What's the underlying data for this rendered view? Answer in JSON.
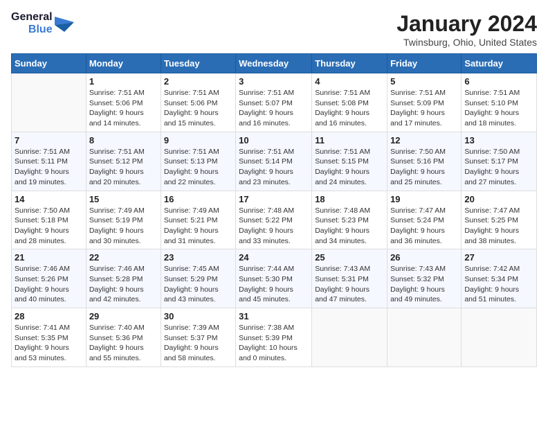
{
  "header": {
    "logo_general": "General",
    "logo_blue": "Blue",
    "month_title": "January 2024",
    "location": "Twinsburg, Ohio, United States"
  },
  "calendar": {
    "days_of_week": [
      "Sunday",
      "Monday",
      "Tuesday",
      "Wednesday",
      "Thursday",
      "Friday",
      "Saturday"
    ],
    "weeks": [
      [
        {
          "day": "",
          "info": ""
        },
        {
          "day": "1",
          "info": "Sunrise: 7:51 AM\nSunset: 5:06 PM\nDaylight: 9 hours\nand 14 minutes."
        },
        {
          "day": "2",
          "info": "Sunrise: 7:51 AM\nSunset: 5:06 PM\nDaylight: 9 hours\nand 15 minutes."
        },
        {
          "day": "3",
          "info": "Sunrise: 7:51 AM\nSunset: 5:07 PM\nDaylight: 9 hours\nand 16 minutes."
        },
        {
          "day": "4",
          "info": "Sunrise: 7:51 AM\nSunset: 5:08 PM\nDaylight: 9 hours\nand 16 minutes."
        },
        {
          "day": "5",
          "info": "Sunrise: 7:51 AM\nSunset: 5:09 PM\nDaylight: 9 hours\nand 17 minutes."
        },
        {
          "day": "6",
          "info": "Sunrise: 7:51 AM\nSunset: 5:10 PM\nDaylight: 9 hours\nand 18 minutes."
        }
      ],
      [
        {
          "day": "7",
          "info": "Sunrise: 7:51 AM\nSunset: 5:11 PM\nDaylight: 9 hours\nand 19 minutes."
        },
        {
          "day": "8",
          "info": "Sunrise: 7:51 AM\nSunset: 5:12 PM\nDaylight: 9 hours\nand 20 minutes."
        },
        {
          "day": "9",
          "info": "Sunrise: 7:51 AM\nSunset: 5:13 PM\nDaylight: 9 hours\nand 22 minutes."
        },
        {
          "day": "10",
          "info": "Sunrise: 7:51 AM\nSunset: 5:14 PM\nDaylight: 9 hours\nand 23 minutes."
        },
        {
          "day": "11",
          "info": "Sunrise: 7:51 AM\nSunset: 5:15 PM\nDaylight: 9 hours\nand 24 minutes."
        },
        {
          "day": "12",
          "info": "Sunrise: 7:50 AM\nSunset: 5:16 PM\nDaylight: 9 hours\nand 25 minutes."
        },
        {
          "day": "13",
          "info": "Sunrise: 7:50 AM\nSunset: 5:17 PM\nDaylight: 9 hours\nand 27 minutes."
        }
      ],
      [
        {
          "day": "14",
          "info": "Sunrise: 7:50 AM\nSunset: 5:18 PM\nDaylight: 9 hours\nand 28 minutes."
        },
        {
          "day": "15",
          "info": "Sunrise: 7:49 AM\nSunset: 5:19 PM\nDaylight: 9 hours\nand 30 minutes."
        },
        {
          "day": "16",
          "info": "Sunrise: 7:49 AM\nSunset: 5:21 PM\nDaylight: 9 hours\nand 31 minutes."
        },
        {
          "day": "17",
          "info": "Sunrise: 7:48 AM\nSunset: 5:22 PM\nDaylight: 9 hours\nand 33 minutes."
        },
        {
          "day": "18",
          "info": "Sunrise: 7:48 AM\nSunset: 5:23 PM\nDaylight: 9 hours\nand 34 minutes."
        },
        {
          "day": "19",
          "info": "Sunrise: 7:47 AM\nSunset: 5:24 PM\nDaylight: 9 hours\nand 36 minutes."
        },
        {
          "day": "20",
          "info": "Sunrise: 7:47 AM\nSunset: 5:25 PM\nDaylight: 9 hours\nand 38 minutes."
        }
      ],
      [
        {
          "day": "21",
          "info": "Sunrise: 7:46 AM\nSunset: 5:26 PM\nDaylight: 9 hours\nand 40 minutes."
        },
        {
          "day": "22",
          "info": "Sunrise: 7:46 AM\nSunset: 5:28 PM\nDaylight: 9 hours\nand 42 minutes."
        },
        {
          "day": "23",
          "info": "Sunrise: 7:45 AM\nSunset: 5:29 PM\nDaylight: 9 hours\nand 43 minutes."
        },
        {
          "day": "24",
          "info": "Sunrise: 7:44 AM\nSunset: 5:30 PM\nDaylight: 9 hours\nand 45 minutes."
        },
        {
          "day": "25",
          "info": "Sunrise: 7:43 AM\nSunset: 5:31 PM\nDaylight: 9 hours\nand 47 minutes."
        },
        {
          "day": "26",
          "info": "Sunrise: 7:43 AM\nSunset: 5:32 PM\nDaylight: 9 hours\nand 49 minutes."
        },
        {
          "day": "27",
          "info": "Sunrise: 7:42 AM\nSunset: 5:34 PM\nDaylight: 9 hours\nand 51 minutes."
        }
      ],
      [
        {
          "day": "28",
          "info": "Sunrise: 7:41 AM\nSunset: 5:35 PM\nDaylight: 9 hours\nand 53 minutes."
        },
        {
          "day": "29",
          "info": "Sunrise: 7:40 AM\nSunset: 5:36 PM\nDaylight: 9 hours\nand 55 minutes."
        },
        {
          "day": "30",
          "info": "Sunrise: 7:39 AM\nSunset: 5:37 PM\nDaylight: 9 hours\nand 58 minutes."
        },
        {
          "day": "31",
          "info": "Sunrise: 7:38 AM\nSunset: 5:39 PM\nDaylight: 10 hours\nand 0 minutes."
        },
        {
          "day": "",
          "info": ""
        },
        {
          "day": "",
          "info": ""
        },
        {
          "day": "",
          "info": ""
        }
      ]
    ]
  }
}
